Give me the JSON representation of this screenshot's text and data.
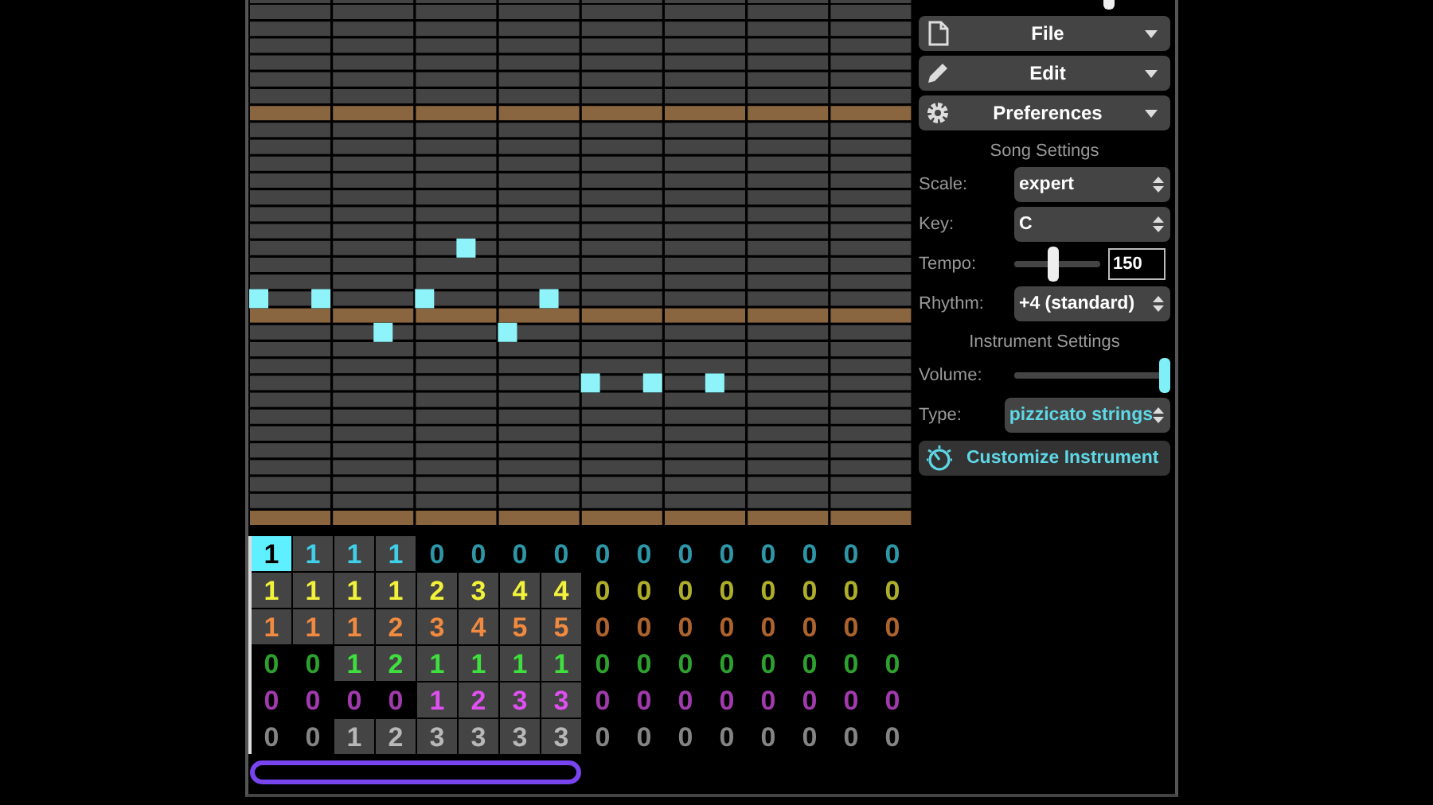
{
  "top_slider": {
    "level": 0.78
  },
  "menus": [
    {
      "label": "File",
      "kind": "file"
    },
    {
      "label": "Edit",
      "kind": "edit"
    },
    {
      "label": "Preferences",
      "kind": "gear"
    }
  ],
  "song_settings": {
    "heading": "Song Settings",
    "scale": {
      "label": "Scale:",
      "value": "expert"
    },
    "key": {
      "label": "Key:",
      "value": "C"
    },
    "tempo": {
      "label": "Tempo:",
      "level": 0.45,
      "value": "150"
    },
    "rhythm": {
      "label": "Rhythm:",
      "value": "+4 (standard)"
    }
  },
  "instrument_settings": {
    "heading": "Instrument Settings",
    "volume": {
      "label": "Volume:",
      "level": 1
    },
    "type": {
      "label": "Type:",
      "value": "pizzicato strings"
    },
    "customize": {
      "label": "Customize Instrument"
    }
  },
  "tracks": [
    {
      "color": "#3fd0e8",
      "cells": [
        {
          "value": "1",
          "used": true,
          "selected": true
        },
        {
          "value": "1",
          "used": true,
          "selected": false
        },
        {
          "value": "1",
          "used": true,
          "selected": false
        },
        {
          "value": "1",
          "used": true,
          "selected": false
        },
        {
          "value": "0",
          "used": false,
          "selected": false
        },
        {
          "value": "0",
          "used": false,
          "selected": false
        },
        {
          "value": "0",
          "used": false,
          "selected": false
        },
        {
          "value": "0",
          "used": false,
          "selected": false
        },
        {
          "value": "0",
          "used": false,
          "selected": false
        },
        {
          "value": "0",
          "used": false,
          "selected": false
        },
        {
          "value": "0",
          "used": false,
          "selected": false
        },
        {
          "value": "0",
          "used": false,
          "selected": false
        },
        {
          "value": "0",
          "used": false,
          "selected": false
        },
        {
          "value": "0",
          "used": false,
          "selected": false
        },
        {
          "value": "0",
          "used": false,
          "selected": false
        },
        {
          "value": "0",
          "used": false,
          "selected": false
        }
      ]
    },
    {
      "color": "#f2f23a",
      "cells": [
        {
          "value": "1",
          "used": true,
          "selected": false
        },
        {
          "value": "1",
          "used": true,
          "selected": false
        },
        {
          "value": "1",
          "used": true,
          "selected": false
        },
        {
          "value": "1",
          "used": true,
          "selected": false
        },
        {
          "value": "2",
          "used": true,
          "selected": false
        },
        {
          "value": "3",
          "used": true,
          "selected": false
        },
        {
          "value": "4",
          "used": true,
          "selected": false
        },
        {
          "value": "4",
          "used": true,
          "selected": false
        },
        {
          "value": "0",
          "used": false,
          "selected": false
        },
        {
          "value": "0",
          "used": false,
          "selected": false
        },
        {
          "value": "0",
          "used": false,
          "selected": false
        },
        {
          "value": "0",
          "used": false,
          "selected": false
        },
        {
          "value": "0",
          "used": false,
          "selected": false
        },
        {
          "value": "0",
          "used": false,
          "selected": false
        },
        {
          "value": "0",
          "used": false,
          "selected": false
        },
        {
          "value": "0",
          "used": false,
          "selected": false
        }
      ]
    },
    {
      "color": "#f08a40",
      "cells": [
        {
          "value": "1",
          "used": true,
          "selected": false
        },
        {
          "value": "1",
          "used": true,
          "selected": false
        },
        {
          "value": "1",
          "used": true,
          "selected": false
        },
        {
          "value": "2",
          "used": true,
          "selected": false
        },
        {
          "value": "3",
          "used": true,
          "selected": false
        },
        {
          "value": "4",
          "used": true,
          "selected": false
        },
        {
          "value": "5",
          "used": true,
          "selected": false
        },
        {
          "value": "5",
          "used": true,
          "selected": false
        },
        {
          "value": "0",
          "used": false,
          "selected": false
        },
        {
          "value": "0",
          "used": false,
          "selected": false
        },
        {
          "value": "0",
          "used": false,
          "selected": false
        },
        {
          "value": "0",
          "used": false,
          "selected": false
        },
        {
          "value": "0",
          "used": false,
          "selected": false
        },
        {
          "value": "0",
          "used": false,
          "selected": false
        },
        {
          "value": "0",
          "used": false,
          "selected": false
        },
        {
          "value": "0",
          "used": false,
          "selected": false
        }
      ]
    },
    {
      "color": "#3ee03e",
      "cells": [
        {
          "value": "0",
          "used": false,
          "selected": false
        },
        {
          "value": "0",
          "used": false,
          "selected": false
        },
        {
          "value": "1",
          "used": true,
          "selected": false
        },
        {
          "value": "2",
          "used": true,
          "selected": false
        },
        {
          "value": "1",
          "used": true,
          "selected": false
        },
        {
          "value": "1",
          "used": true,
          "selected": false
        },
        {
          "value": "1",
          "used": true,
          "selected": false
        },
        {
          "value": "1",
          "used": true,
          "selected": false
        },
        {
          "value": "0",
          "used": false,
          "selected": false
        },
        {
          "value": "0",
          "used": false,
          "selected": false
        },
        {
          "value": "0",
          "used": false,
          "selected": false
        },
        {
          "value": "0",
          "used": false,
          "selected": false
        },
        {
          "value": "0",
          "used": false,
          "selected": false
        },
        {
          "value": "0",
          "used": false,
          "selected": false
        },
        {
          "value": "0",
          "used": false,
          "selected": false
        },
        {
          "value": "0",
          "used": false,
          "selected": false
        }
      ]
    },
    {
      "color": "#e050f0",
      "cells": [
        {
          "value": "0",
          "used": false,
          "selected": false
        },
        {
          "value": "0",
          "used": false,
          "selected": false
        },
        {
          "value": "0",
          "used": false,
          "selected": false
        },
        {
          "value": "0",
          "used": false,
          "selected": false
        },
        {
          "value": "1",
          "used": true,
          "selected": false
        },
        {
          "value": "2",
          "used": true,
          "selected": false
        },
        {
          "value": "3",
          "used": true,
          "selected": false
        },
        {
          "value": "3",
          "used": true,
          "selected": false
        },
        {
          "value": "0",
          "used": false,
          "selected": false
        },
        {
          "value": "0",
          "used": false,
          "selected": false
        },
        {
          "value": "0",
          "used": false,
          "selected": false
        },
        {
          "value": "0",
          "used": false,
          "selected": false
        },
        {
          "value": "0",
          "used": false,
          "selected": false
        },
        {
          "value": "0",
          "used": false,
          "selected": false
        },
        {
          "value": "0",
          "used": false,
          "selected": false
        },
        {
          "value": "0",
          "used": false,
          "selected": false
        }
      ]
    },
    {
      "color": "#b8b8b8",
      "cells": [
        {
          "value": "0",
          "used": false,
          "selected": false
        },
        {
          "value": "0",
          "used": false,
          "selected": false
        },
        {
          "value": "1",
          "used": true,
          "selected": false
        },
        {
          "value": "2",
          "used": true,
          "selected": false
        },
        {
          "value": "3",
          "used": true,
          "selected": false
        },
        {
          "value": "3",
          "used": true,
          "selected": false
        },
        {
          "value": "3",
          "used": true,
          "selected": false
        },
        {
          "value": "3",
          "used": true,
          "selected": false
        },
        {
          "value": "0",
          "used": false,
          "selected": false
        },
        {
          "value": "0",
          "used": false,
          "selected": false
        },
        {
          "value": "0",
          "used": false,
          "selected": false
        },
        {
          "value": "0",
          "used": false,
          "selected": false
        },
        {
          "value": "0",
          "used": false,
          "selected": false
        },
        {
          "value": "0",
          "used": false,
          "selected": false
        },
        {
          "value": "0",
          "used": false,
          "selected": false
        },
        {
          "value": "0",
          "used": false,
          "selected": false
        }
      ]
    }
  ]
}
